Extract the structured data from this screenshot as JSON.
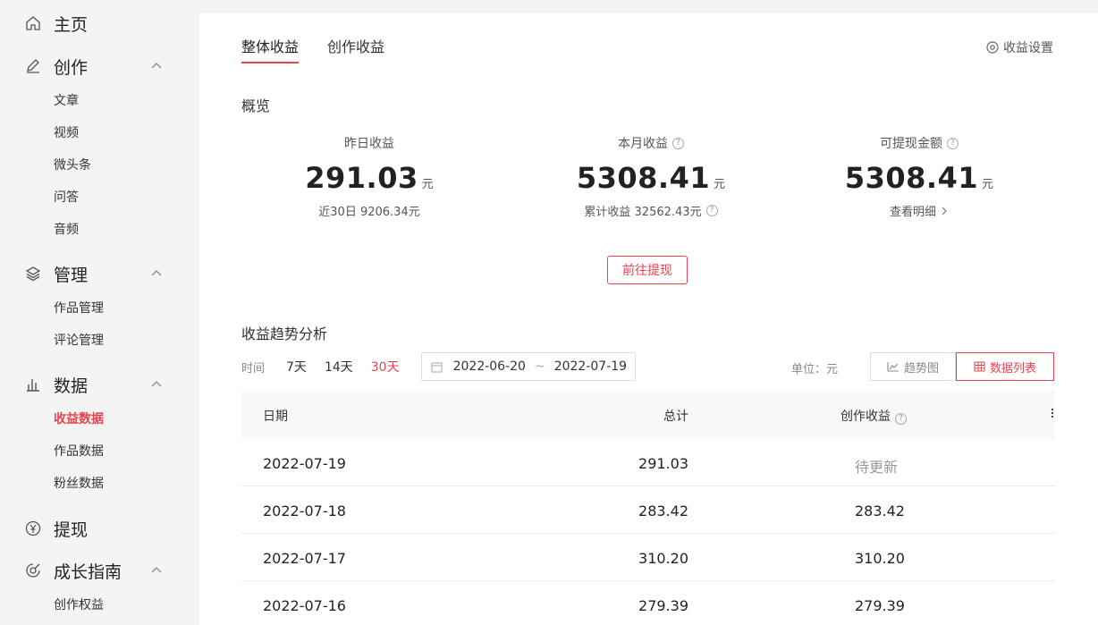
{
  "sidebar": {
    "home": "主页",
    "create": {
      "label": "创作",
      "items": [
        "文章",
        "视频",
        "微头条",
        "问答",
        "音频"
      ]
    },
    "manage": {
      "label": "管理",
      "items": [
        "作品管理",
        "评论管理"
      ]
    },
    "data": {
      "label": "数据",
      "items": [
        "收益数据",
        "作品数据",
        "粉丝数据"
      ],
      "active_index": 0
    },
    "withdraw": "提现",
    "growth": {
      "label": "成长指南",
      "items": [
        "创作权益"
      ]
    }
  },
  "tabs": [
    "整体收益",
    "创作收益"
  ],
  "settings_label": "收益设置",
  "overview": {
    "title": "概览",
    "yesterday": {
      "label": "昨日收益",
      "value": "291.03",
      "unit": "元",
      "sub": "近30日 9206.34元"
    },
    "month": {
      "label": "本月收益",
      "value": "5308.41",
      "unit": "元",
      "sub": "累计收益 32562.43元"
    },
    "withdrawable": {
      "label": "可提现金额",
      "value": "5308.41",
      "unit": "元",
      "sub": "查看明细"
    },
    "withdraw_button": "前往提现"
  },
  "trend": {
    "title": "收益趋势分析",
    "time_label": "时间",
    "ranges": [
      "7天",
      "14天",
      "30天"
    ],
    "active_range": "30天",
    "date_start": "2022-06-20",
    "date_sep": "~",
    "date_end": "2022-07-19",
    "unit_label": "单位：元",
    "view_chart": "趋势图",
    "view_table": "数据列表"
  },
  "table": {
    "headers": {
      "date": "日期",
      "total": "总计",
      "income": "创作收益"
    },
    "rows": [
      {
        "date": "2022-07-19",
        "total": "291.03",
        "income": "待更新"
      },
      {
        "date": "2022-07-18",
        "total": "283.42",
        "income": "283.42"
      },
      {
        "date": "2022-07-17",
        "total": "310.20",
        "income": "310.20"
      },
      {
        "date": "2022-07-16",
        "total": "279.39",
        "income": "279.39"
      }
    ]
  },
  "colors": {
    "accent": "#e8434e"
  }
}
